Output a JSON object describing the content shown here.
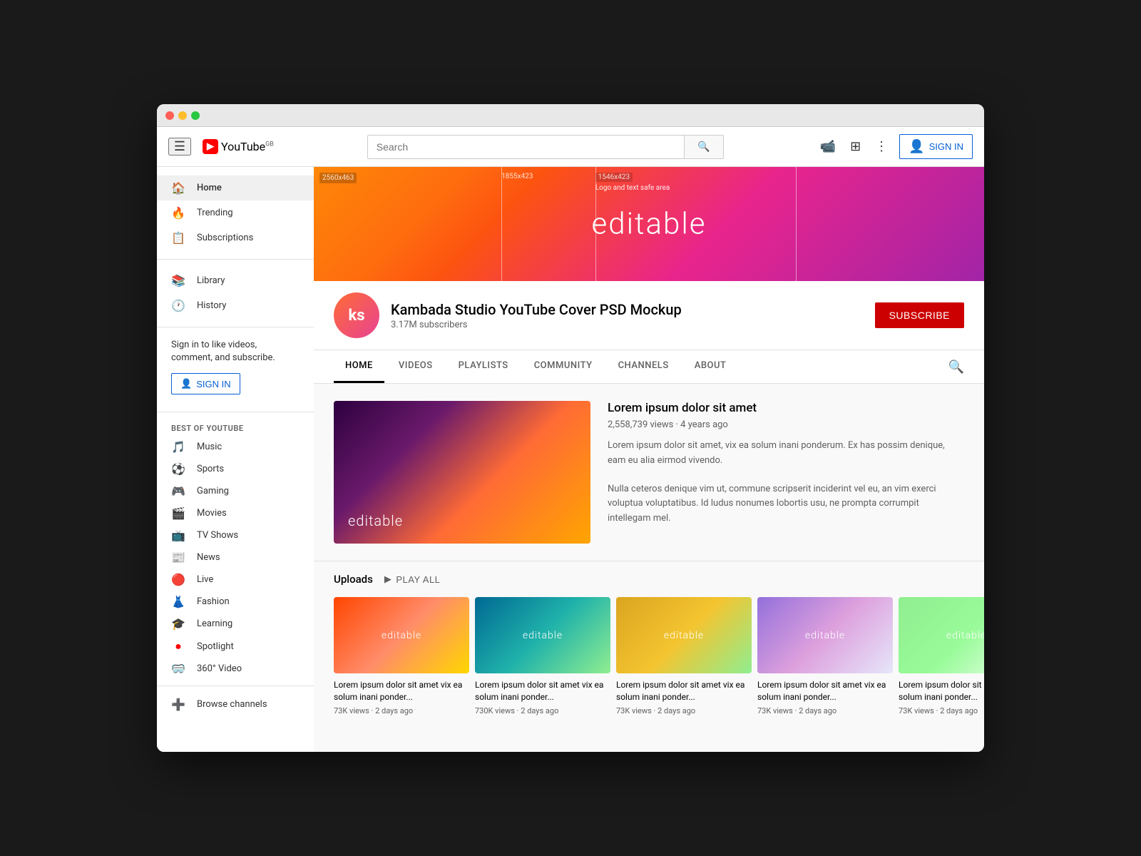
{
  "window": {
    "title": "YouTube"
  },
  "header": {
    "menu_label": "☰",
    "logo_text": "YouTube",
    "logo_gb": "GB",
    "search_placeholder": "Search",
    "search_btn_icon": "🔍",
    "upload_icon": "📹",
    "apps_icon": "⊞",
    "more_icon": "⋮",
    "sign_in_label": "SIGN IN"
  },
  "sidebar": {
    "nav_items": [
      {
        "icon": "🏠",
        "label": "Home"
      },
      {
        "icon": "🔥",
        "label": "Trending"
      },
      {
        "icon": "📋",
        "label": "Subscriptions"
      }
    ],
    "library_items": [
      {
        "icon": "📚",
        "label": "Library"
      },
      {
        "icon": "🕐",
        "label": "History"
      }
    ],
    "sign_in_text": "Sign in to like videos, comment, and subscribe.",
    "sign_in_btn": "SIGN IN",
    "best_of_title": "BEST OF YOUTUBE",
    "best_items": [
      {
        "icon": "🎵",
        "label": "Music"
      },
      {
        "icon": "⚽",
        "label": "Sports"
      },
      {
        "icon": "🎮",
        "label": "Gaming"
      },
      {
        "icon": "🎬",
        "label": "Movies"
      },
      {
        "icon": "📺",
        "label": "TV Shows"
      },
      {
        "icon": "📰",
        "label": "News"
      },
      {
        "icon": "🔴",
        "label": "Live"
      },
      {
        "icon": "👗",
        "label": "Fashion"
      },
      {
        "icon": "🎓",
        "label": "Learning"
      },
      {
        "icon": "🔴",
        "label": "Spotlight"
      },
      {
        "icon": "🥽",
        "label": "360° Video"
      }
    ],
    "browse_label": "Browse channels"
  },
  "banner": {
    "guide1": "2560x463",
    "guide2": "1855x423",
    "guide3": "1546x423",
    "safe_label": "Logo and text safe area",
    "editable_text": "editable"
  },
  "channel": {
    "avatar_text": "ks",
    "name": "Kambada Studio YouTube Cover PSD Mockup",
    "subscribers": "3.17M subscribers",
    "subscribe_label": "SUBSCRIBE"
  },
  "tabs": [
    {
      "label": "HOME",
      "active": true
    },
    {
      "label": "VIDEOS",
      "active": false
    },
    {
      "label": "PLAYLISTS",
      "active": false
    },
    {
      "label": "COMMUNITY",
      "active": false
    },
    {
      "label": "CHANNELS",
      "active": false
    },
    {
      "label": "ABOUT",
      "active": false
    }
  ],
  "featured": {
    "thumb_text": "editable",
    "title": "Lorem ipsum dolor sit amet",
    "meta": "2,558,739 views · 4 years ago",
    "desc1": "Lorem ipsum dolor sit amet, vix ea solum inani ponderum. Ex has possim denique, eam eu alia eirmod vivendo.",
    "desc2": "Nulla ceteros denique vim ut, commune scripserit inciderint vel eu, an vim exerci voluptua voluptatibus. Id ludus nonumes lobortis usu, ne prompta corrumpit intellegam mel."
  },
  "uploads": {
    "title": "Uploads",
    "play_all": "PLAY ALL",
    "videos": [
      {
        "thumb_class": "thumb-1",
        "title": "Lorem ipsum dolor sit amet vix ea solum inani ponder...",
        "meta": "73K views · 2 days ago"
      },
      {
        "thumb_class": "thumb-2",
        "title": "Lorem ipsum dolor sit amet vix ea solum inani ponder...",
        "meta": "730K views · 2 days ago"
      },
      {
        "thumb_class": "thumb-3",
        "title": "Lorem ipsum dolor sit amet vix ea solum inani ponder...",
        "meta": "73K views · 2 days ago"
      },
      {
        "thumb_class": "thumb-4",
        "title": "Lorem ipsum dolor sit amet vix ea solum inani ponder...",
        "meta": "73K views · 2 days ago"
      },
      {
        "thumb_class": "thumb-5",
        "title": "Lorem ipsum dolor sit amet vix ea solum inani ponder...",
        "meta": "73K views · 2 days ago"
      }
    ]
  },
  "colors": {
    "yt_red": "#cc0000",
    "sign_in_blue": "#065fd4",
    "text_primary": "#030303",
    "text_secondary": "#606060"
  }
}
